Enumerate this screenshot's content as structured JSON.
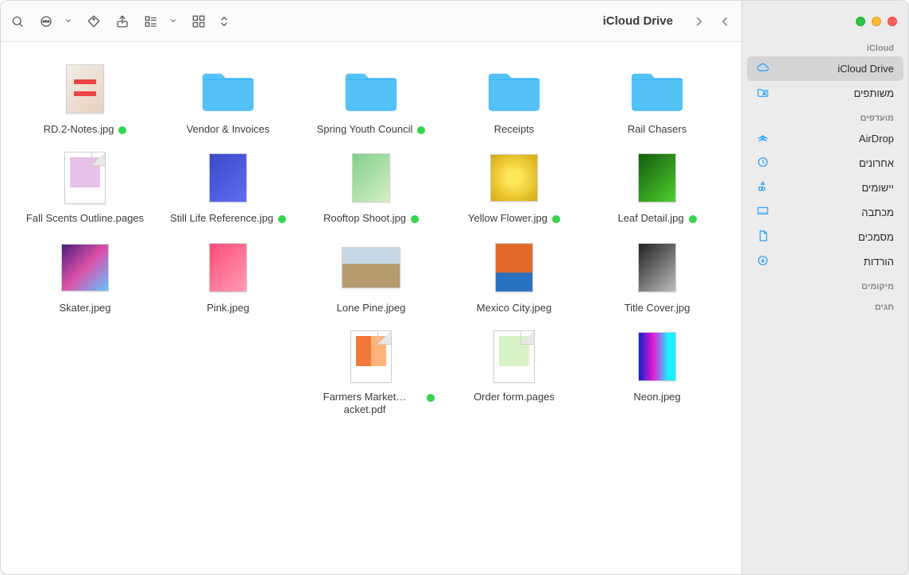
{
  "window_title": "iCloud Drive",
  "sidebar": {
    "sections": [
      {
        "title": "iCloud",
        "items": [
          {
            "label": "iCloud Drive",
            "icon": "cloud-icon",
            "active": true
          },
          {
            "label": "משותפים",
            "icon": "shared-folder-icon",
            "active": false
          }
        ]
      },
      {
        "title": "מועדפים",
        "items": [
          {
            "label": "AirDrop",
            "icon": "airdrop-icon"
          },
          {
            "label": "אחרונים",
            "icon": "clock-icon"
          },
          {
            "label": "יישומים",
            "icon": "apps-icon"
          },
          {
            "label": "מכתבה",
            "icon": "desktop-icon"
          },
          {
            "label": "מסמכים",
            "icon": "documents-icon"
          },
          {
            "label": "הורדות",
            "icon": "downloads-icon"
          }
        ]
      },
      {
        "title": "מיקומים",
        "items": []
      },
      {
        "title": "תגים",
        "items": []
      }
    ]
  },
  "files": [
    {
      "name": "RD.2-Notes.jpg",
      "kind": "image",
      "variant": "t-notes",
      "shape": "tall",
      "tagged": true
    },
    {
      "name": "Vendor & Invoices",
      "kind": "folder"
    },
    {
      "name": "Spring Youth Council",
      "kind": "folder",
      "tagged": true
    },
    {
      "name": "Receipts",
      "kind": "folder"
    },
    {
      "name": "Rail Chasers",
      "kind": "folder"
    },
    {
      "name": "Fall Scents Outline.pages",
      "kind": "page",
      "variant": "t-scents",
      "shape": "wide"
    },
    {
      "name": "Still Life Reference.jpg",
      "kind": "image",
      "variant": "t-blue",
      "shape": "tall",
      "tagged": true
    },
    {
      "name": "Rooftop Shoot.jpg",
      "kind": "image",
      "variant": "t-roof",
      "shape": "tall",
      "tagged": true
    },
    {
      "name": "Yellow Flower.jpg",
      "kind": "image",
      "variant": "t-yellow",
      "shape": "",
      "tagged": true
    },
    {
      "name": "Leaf Detail.jpg",
      "kind": "image",
      "variant": "t-leaf",
      "shape": "tall",
      "tagged": true
    },
    {
      "name": "Skater.jpeg",
      "kind": "image",
      "variant": "t-skater",
      "shape": ""
    },
    {
      "name": "Pink.jpeg",
      "kind": "image",
      "variant": "t-pinkport",
      "shape": "tall"
    },
    {
      "name": "Lone Pine.jpeg",
      "kind": "image",
      "variant": "t-desert",
      "shape": "wide"
    },
    {
      "name": "Mexico City.jpeg",
      "kind": "image",
      "variant": "t-mexico",
      "shape": "tall"
    },
    {
      "name": "Title Cover.jpg",
      "kind": "image",
      "variant": "t-bw",
      "shape": "tall"
    },
    {
      "name": "",
      "kind": "blank"
    },
    {
      "name": "",
      "kind": "blank"
    },
    {
      "name": "Farmers Market…acket.pdf",
      "kind": "page",
      "variant": "t-market",
      "shape": "wide",
      "tagged": true
    },
    {
      "name": "Order form.pages",
      "kind": "page",
      "variant": "t-order",
      "shape": "tall"
    },
    {
      "name": "Neon.jpeg",
      "kind": "image",
      "variant": "t-neon",
      "shape": "tall"
    }
  ]
}
